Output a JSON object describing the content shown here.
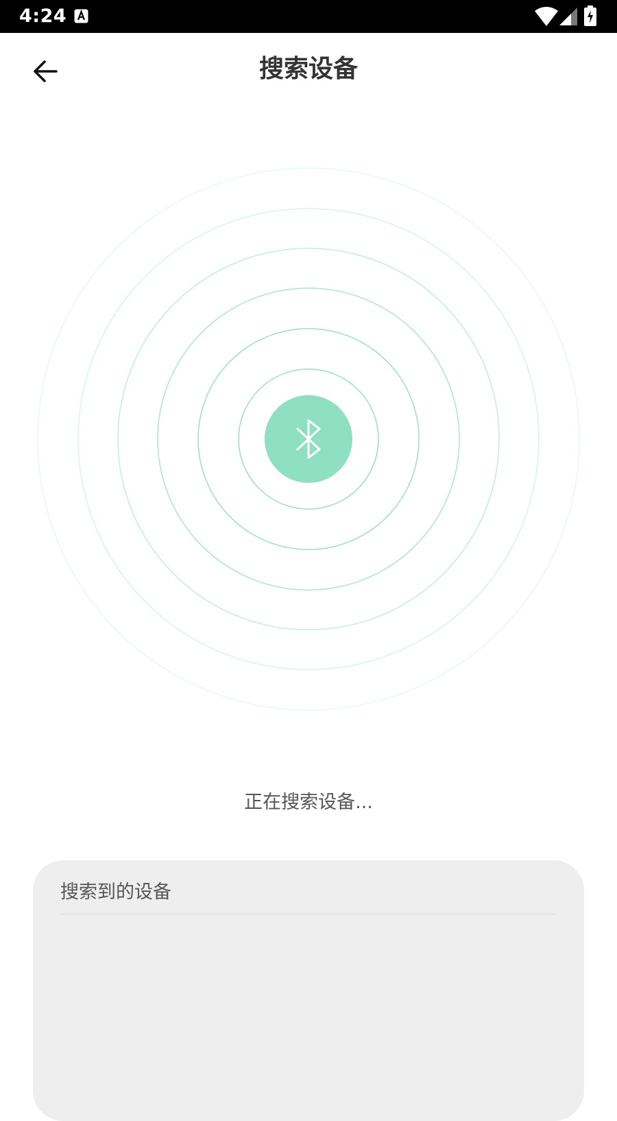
{
  "status_bar": {
    "time": "4:24",
    "icons": [
      "text-a-icon",
      "wifi-icon",
      "cell-signal-icon",
      "battery-charging-icon"
    ]
  },
  "header": {
    "back_icon": "arrow-left-icon",
    "title": "搜索设备"
  },
  "radar": {
    "icon": "bluetooth-icon",
    "accent_color": "#8fe0c2",
    "ring_color": "#8fdcc4"
  },
  "search_status": "正在搜索设备...",
  "device_panel": {
    "title": "搜索到的设备",
    "devices": []
  }
}
